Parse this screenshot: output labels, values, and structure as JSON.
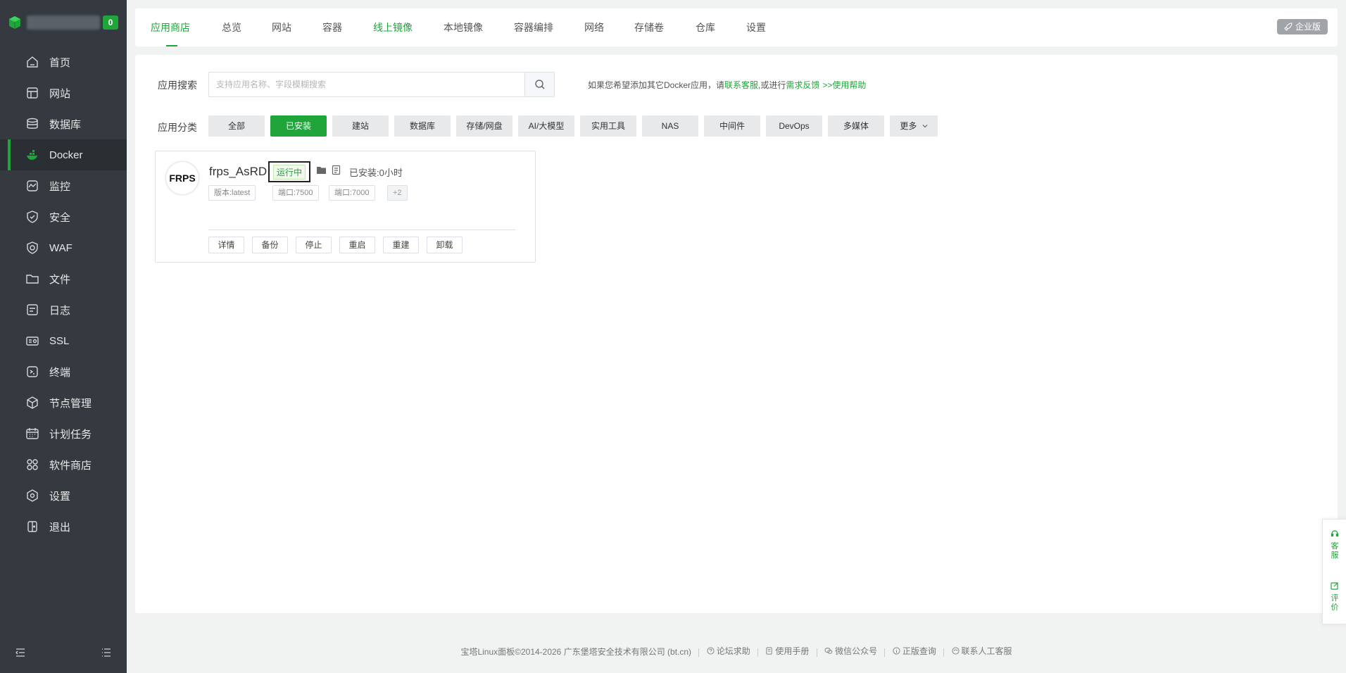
{
  "sidebar": {
    "badge": "0",
    "items": [
      {
        "label": "首页",
        "icon": "home-icon"
      },
      {
        "label": "网站",
        "icon": "website-icon"
      },
      {
        "label": "数据库",
        "icon": "database-icon"
      },
      {
        "label": "Docker",
        "icon": "docker-icon"
      },
      {
        "label": "监控",
        "icon": "monitor-icon"
      },
      {
        "label": "安全",
        "icon": "shield-icon"
      },
      {
        "label": "WAF",
        "icon": "waf-icon"
      },
      {
        "label": "文件",
        "icon": "folder-icon"
      },
      {
        "label": "日志",
        "icon": "log-icon"
      },
      {
        "label": "SSL",
        "icon": "ssl-icon"
      },
      {
        "label": "终端",
        "icon": "terminal-icon"
      },
      {
        "label": "节点管理",
        "icon": "node-icon"
      },
      {
        "label": "计划任务",
        "icon": "calendar-icon"
      },
      {
        "label": "软件商店",
        "icon": "apps-icon"
      },
      {
        "label": "设置",
        "icon": "gear-icon"
      },
      {
        "label": "退出",
        "icon": "logout-icon"
      }
    ],
    "active_index": 3
  },
  "tabs": [
    "应用商店",
    "总览",
    "网站",
    "容器",
    "线上镜像",
    "本地镜像",
    "容器编排",
    "网络",
    "存储卷",
    "仓库",
    "设置"
  ],
  "enterprise_label": "企业版",
  "search": {
    "label": "应用搜索",
    "placeholder": "支持应用名称、字段模糊搜索",
    "value": "",
    "hint_prefix": "如果您希望添加其它Docker应用，请",
    "hint_link1": "联系客服",
    "hint_mid": ",或进行",
    "hint_link2": "需求反馈",
    "hint_link3": ">>使用帮助"
  },
  "categories": {
    "label": "应用分类",
    "items": [
      "全部",
      "已安装",
      "建站",
      "数据库",
      "存储/网盘",
      "AI/大模型",
      "实用工具",
      "NAS",
      "中间件",
      "DevOps",
      "多媒体",
      "更多"
    ],
    "active_index": 1
  },
  "app_card": {
    "logo_text": "FRPS",
    "name": "frps_AsRD",
    "status": "运行中",
    "installed": "已安装:0小时",
    "tags": [
      "版本:latest",
      "端口:7500",
      "端口:7000",
      "+2"
    ],
    "actions": [
      "详情",
      "备份",
      "停止",
      "重启",
      "重建",
      "卸载"
    ]
  },
  "float": {
    "service": "客服",
    "review": "评价"
  },
  "footer": {
    "copyright": "宝塔Linux面板©2014-2026 广东堡塔安全技术有限公司 (bt.cn)",
    "links": [
      "论坛求助",
      "使用手册",
      "微信公众号",
      "正版查询",
      "联系人工客服"
    ]
  },
  "colors": {
    "accent": "#20a53a",
    "sidebar": "#343a40"
  }
}
